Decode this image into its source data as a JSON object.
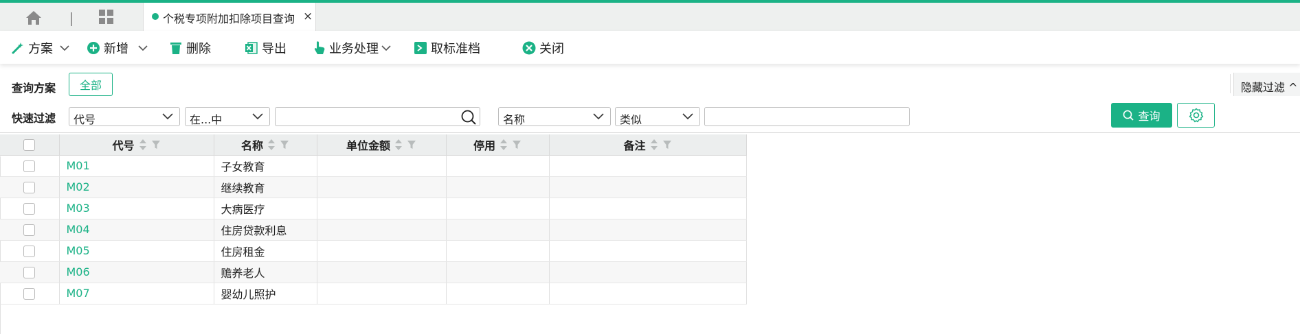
{
  "tabs": {
    "active_title": "个税专项附加扣除项目查询",
    "close_glyph": "×"
  },
  "toolbar": {
    "plan": "方案",
    "add": "新增",
    "delete": "删除",
    "export": "导出",
    "business": "业务处理",
    "unarchive": "取标准档",
    "close": "关闭"
  },
  "query_plan": {
    "label": "查询方案",
    "all_button": "全部",
    "hide_filter": "隐藏过滤 ^"
  },
  "quick_filter": {
    "label": "快速过滤",
    "field1": "代号",
    "op1": "在...中",
    "value1": "",
    "field2": "名称",
    "op2": "类似",
    "value2": "",
    "search_button": "查询"
  },
  "table": {
    "columns": [
      "代号",
      "名称",
      "单位金额",
      "停用",
      "备注"
    ],
    "rows": [
      {
        "code": "M01",
        "name": "子女教育",
        "amount": "",
        "disabled": "",
        "remark": ""
      },
      {
        "code": "M02",
        "name": "继续教育",
        "amount": "",
        "disabled": "",
        "remark": ""
      },
      {
        "code": "M03",
        "name": "大病医疗",
        "amount": "",
        "disabled": "",
        "remark": ""
      },
      {
        "code": "M04",
        "name": "住房贷款利息",
        "amount": "",
        "disabled": "",
        "remark": ""
      },
      {
        "code": "M05",
        "name": "住房租金",
        "amount": "",
        "disabled": "",
        "remark": ""
      },
      {
        "code": "M06",
        "name": "赡养老人",
        "amount": "",
        "disabled": "",
        "remark": ""
      },
      {
        "code": "M07",
        "name": "婴幼儿照护",
        "amount": "",
        "disabled": "",
        "remark": ""
      }
    ]
  },
  "colors": {
    "accent": "#1bb286",
    "tabbar": "#eef0ef",
    "header_bg": "#eceeee"
  }
}
